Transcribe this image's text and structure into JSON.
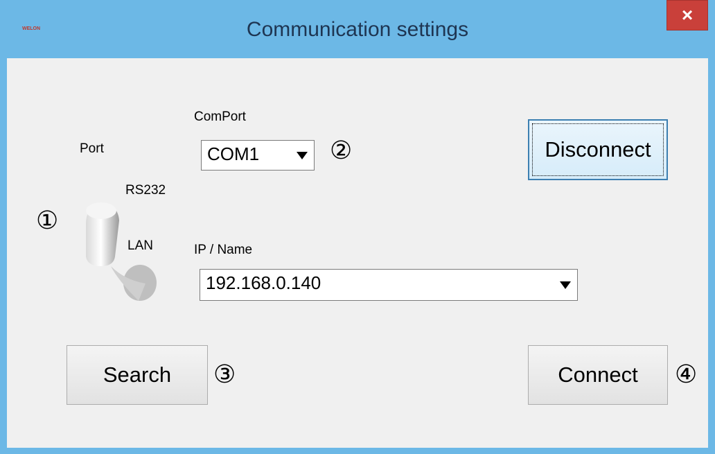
{
  "window": {
    "title": "Communication settings",
    "logo_text": "WELON",
    "close_label": "×"
  },
  "port": {
    "label": "Port",
    "option_rs232": "RS232",
    "option_lan": "LAN",
    "selected": "LAN"
  },
  "comport": {
    "label": "ComPort",
    "value": "COM1"
  },
  "ip": {
    "label": "IP / Name",
    "value": "192.168.0.140"
  },
  "buttons": {
    "disconnect": "Disconnect",
    "search": "Search",
    "connect": "Connect"
  },
  "markers": [
    "①",
    "②",
    "③",
    "④"
  ],
  "colors": {
    "titlebar": "#6cb8e6",
    "close": "#c9403a",
    "focus_border": "#3c7fb1"
  }
}
